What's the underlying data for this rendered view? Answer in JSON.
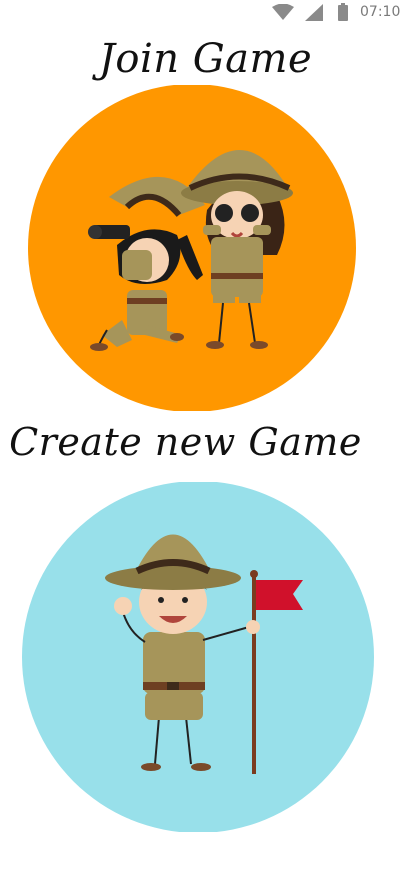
{
  "status_bar": {
    "time": "07:10",
    "icons": [
      "wifi-icon",
      "cell-signal-icon",
      "battery-icon"
    ]
  },
  "join": {
    "title": "Join Game",
    "circle_color": "#FF9700",
    "illustration": "scout-kids-binoculars"
  },
  "create": {
    "title": "Create new Game",
    "circle_color": "#98E0EA",
    "illustration": "scout-boy-with-flag"
  },
  "colors": {
    "khaki": "#A6955A",
    "khaki_dark": "#7E6F3C",
    "hat_band": "#3E2A1A",
    "flag_red": "#D0112B",
    "skin": "#F6D3B4"
  }
}
